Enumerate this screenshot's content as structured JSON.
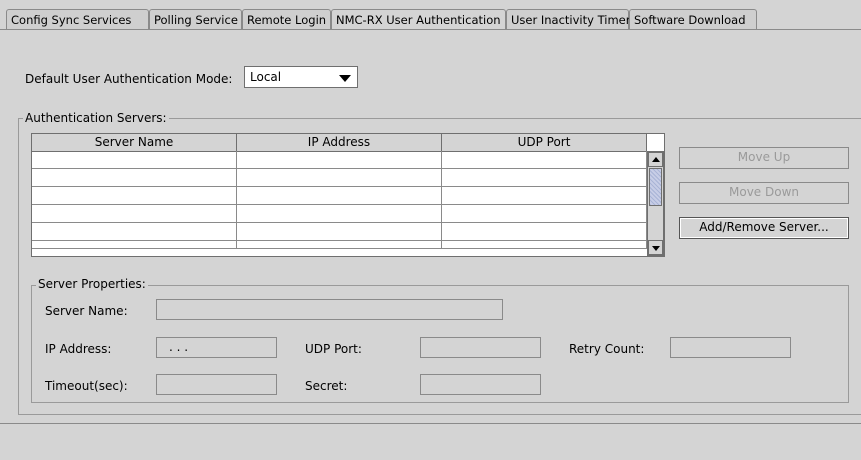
{
  "tabs": [
    {
      "label": "Config Sync Services"
    },
    {
      "label": "Polling Service"
    },
    {
      "label": "Remote Login"
    },
    {
      "label": "NMC-RX User Authentication"
    },
    {
      "label": "User Inactivity Timer"
    },
    {
      "label": "Software Download"
    }
  ],
  "auth_mode": {
    "label": "Default User Authentication Mode:",
    "value": "Local"
  },
  "auth_servers": {
    "title": "Authentication Servers:",
    "columns": [
      "Server Name",
      "IP Address",
      "UDP Port"
    ],
    "rows": [
      [
        "",
        "",
        ""
      ],
      [
        "",
        "",
        ""
      ],
      [
        "",
        "",
        ""
      ],
      [
        "",
        "",
        ""
      ],
      [
        "",
        "",
        ""
      ]
    ]
  },
  "buttons": {
    "move_up": "Move Up",
    "move_down": "Move Down",
    "add_remove": "Add/Remove Server..."
  },
  "server_properties": {
    "title": "Server Properties:",
    "server_name_label": "Server Name:",
    "server_name_value": "",
    "ip_address_label": "IP Address:",
    "ip_address_value": ". . .",
    "udp_port_label": "UDP Port:",
    "udp_port_value": "",
    "retry_count_label": "Retry Count:",
    "retry_count_value": "",
    "timeout_label": "Timeout(sec):",
    "timeout_value": "",
    "secret_label": "Secret:",
    "secret_value": ""
  }
}
